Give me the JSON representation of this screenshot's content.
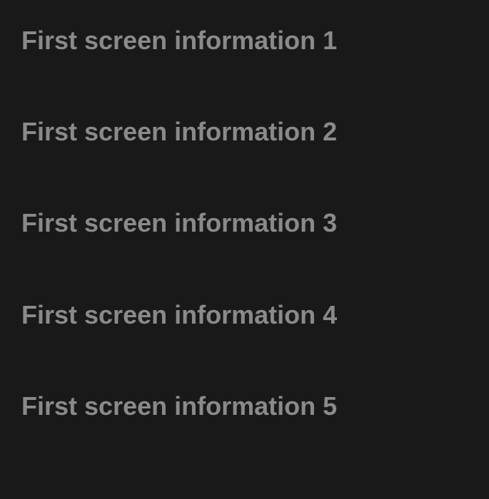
{
  "headings": [
    "First screen information 1",
    "First screen information 2",
    "First screen information 3",
    "First screen information 4",
    "First screen information 5"
  ]
}
